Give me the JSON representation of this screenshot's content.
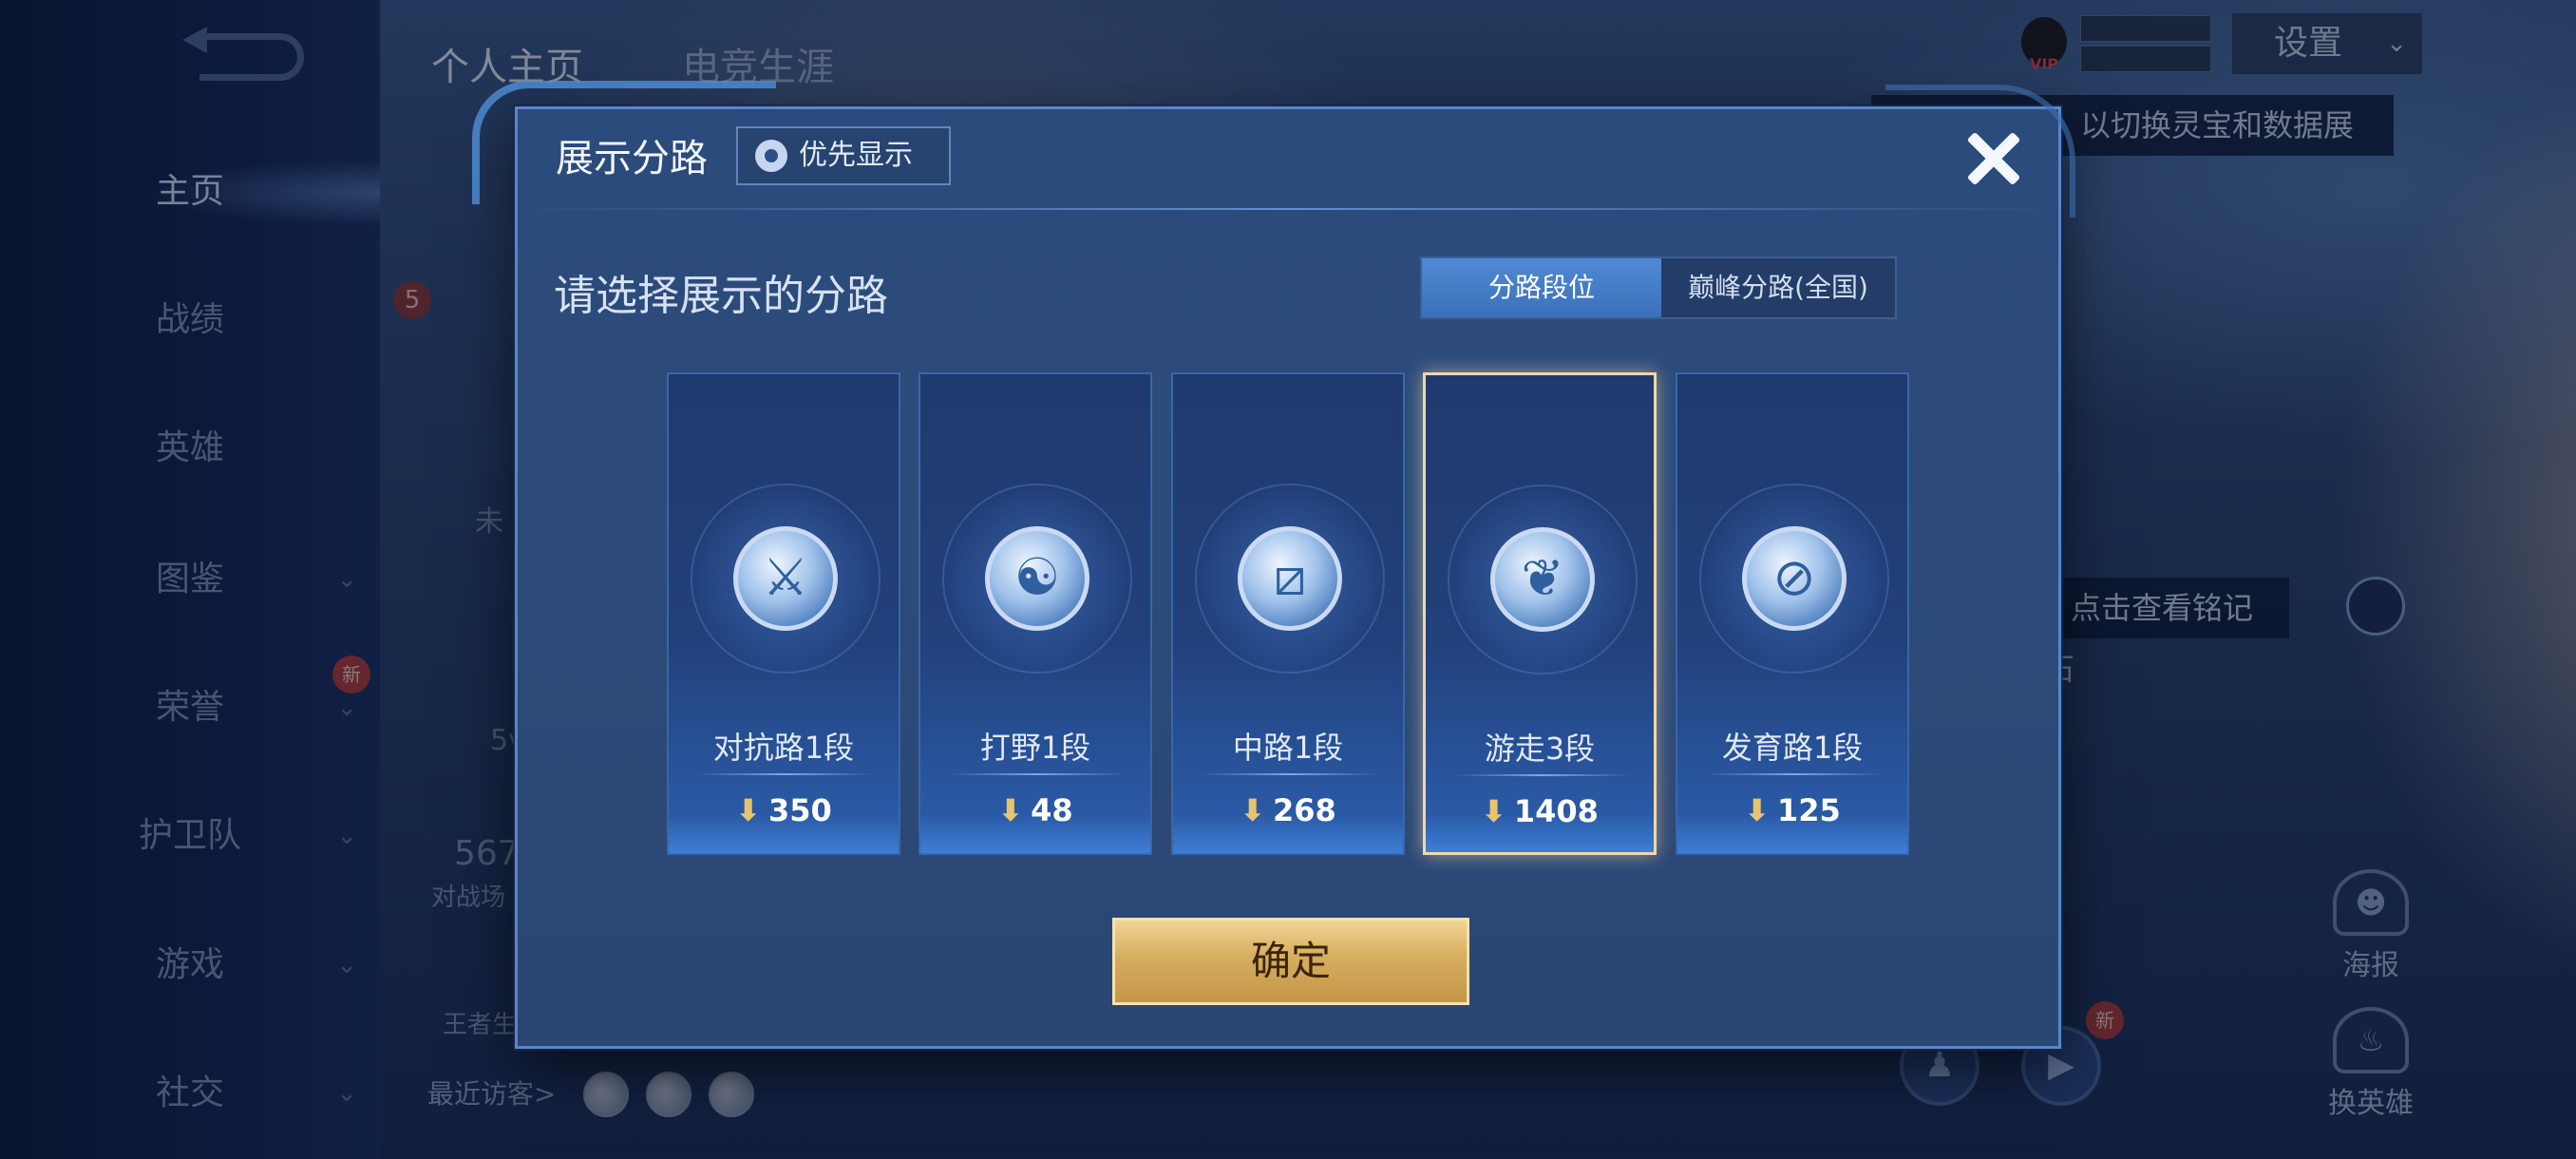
{
  "top_tabs": [
    "个人主页",
    "电竞生涯"
  ],
  "sidebar": {
    "items": [
      {
        "label": "主页",
        "chevron": false
      },
      {
        "label": "战绩",
        "chevron": false
      },
      {
        "label": "英雄",
        "chevron": false
      },
      {
        "label": "图鉴",
        "chevron": true
      },
      {
        "label": "荣誉",
        "chevron": true,
        "badge": "新"
      },
      {
        "label": "护卫队",
        "chevron": true
      },
      {
        "label": "游戏",
        "chevron": true
      },
      {
        "label": "社交",
        "chevron": true
      }
    ]
  },
  "background": {
    "recent_visitors": "最近访客>",
    "settings": "设置",
    "vip": "VIP",
    "tooltip_top": "以切换灵宝和数据展示",
    "tooltip_mid": "点击查看铭记之石",
    "poster": "海报",
    "change_hero": "换英雄",
    "new_badge": "新",
    "level_badge": "5",
    "partial_5v": "5v",
    "partial_567": "567",
    "partial_battle": "对战场",
    "partial_king": "王者生",
    "partial_not": "未"
  },
  "modal": {
    "title": "展示分路",
    "priority_button": "优先显示",
    "prompt": "请选择展示的分路",
    "segmented": {
      "options": [
        "分路段位",
        "巅峰分路(全国)"
      ],
      "selected_index": 0
    },
    "lanes": [
      {
        "label": "对抗路1段",
        "score": "350",
        "icon": "clash-lane-icon",
        "glyph": "⚔"
      },
      {
        "label": "打野1段",
        "score": "48",
        "icon": "jungle-icon",
        "glyph": "☯"
      },
      {
        "label": "中路1段",
        "score": "268",
        "icon": "mid-lane-icon",
        "glyph": "⧄"
      },
      {
        "label": "游走3段",
        "score": "1408",
        "icon": "roam-icon",
        "glyph": "❦",
        "selected": true
      },
      {
        "label": "发育路1段",
        "score": "125",
        "icon": "farm-lane-icon",
        "glyph": "⊘"
      }
    ],
    "confirm": "确定"
  },
  "colors": {
    "modal_bg": "#2b4b7c",
    "accent_gold": "#d6ad5f",
    "selected_border": "#f3d6a8",
    "segment_active": "#4f8ad4"
  }
}
